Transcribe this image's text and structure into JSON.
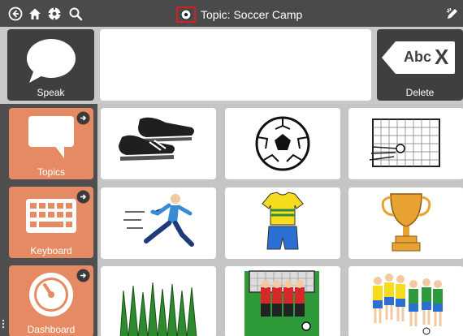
{
  "topbar": {
    "icons": [
      "back-icon",
      "home-icon",
      "settings-icon",
      "search-icon",
      "edit-icon"
    ],
    "title": "Topic: Soccer Camp",
    "title_icon": "soccer-ball-icon"
  },
  "message_bar": {
    "value": ""
  },
  "actions": {
    "speak_label": "Speak",
    "delete_label": "Delete",
    "delete_icon_text": "Abc",
    "delete_icon_x": "X"
  },
  "sidebar": {
    "items": [
      {
        "label": "Topics",
        "icon": "speech-bubble-icon"
      },
      {
        "label": "Keyboard",
        "icon": "keyboard-icon"
      },
      {
        "label": "Dashboard",
        "icon": "dashboard-gauge-icon"
      }
    ]
  },
  "grid": {
    "tiles": [
      {
        "name": "soccer-cleats",
        "icon": "soccer-cleats-icon"
      },
      {
        "name": "soccer-ball",
        "icon": "soccer-ball-icon"
      },
      {
        "name": "goal",
        "icon": "soccer-goal-icon"
      },
      {
        "name": "running-player",
        "icon": "running-player-icon"
      },
      {
        "name": "jersey",
        "icon": "soccer-jersey-icon"
      },
      {
        "name": "trophy",
        "icon": "trophy-icon"
      },
      {
        "name": "grass-field",
        "icon": "grass-icon"
      },
      {
        "name": "penalty-wall",
        "icon": "goal-wall-players-icon"
      },
      {
        "name": "team",
        "icon": "soccer-team-icon"
      }
    ]
  },
  "colors": {
    "topbar": "#4a4a4a",
    "action_button": "#3f3f3f",
    "sidebar_button": "#e58a62",
    "sidebar_panel": "#4f4f4f",
    "grid_background": "#c5c5c5",
    "title_highlight": "#d61f1f"
  }
}
